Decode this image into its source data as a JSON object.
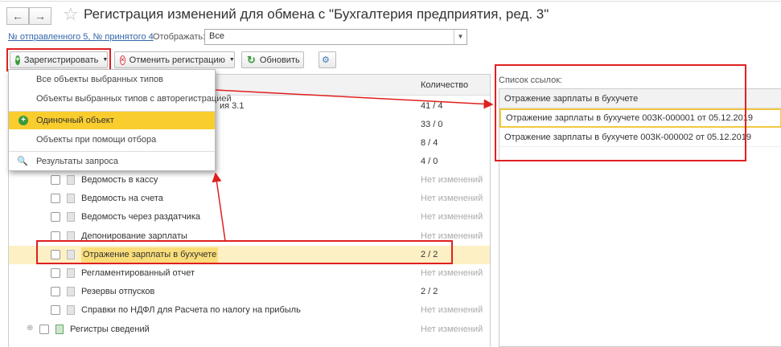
{
  "window": {
    "title": "Регистрация изменений для обмена с  \"Бухгалтерия предприятия, ред. 3\"",
    "back": "←",
    "forward": "→",
    "star": "☆"
  },
  "info": {
    "link": "№ отправленного 5, № принятого 4",
    "display_label": "Отображать:",
    "display_value": "Все"
  },
  "toolbar": {
    "register": "Зарегистрировать",
    "unregister": "Отменить регистрацию",
    "refresh": "Обновить"
  },
  "menu": {
    "items": [
      "Все объекты выбранных типов",
      "Объекты выбранных типов с авторегистрацией",
      "Одиночный объект",
      "Объекты при помощи отбора",
      "Результаты запроса"
    ]
  },
  "table": {
    "col_count": "Количество",
    "hidden_rows": [
      {
        "name": "ия 3.1",
        "count": "41 / 4"
      },
      {
        "count": "33 / 0"
      },
      {
        "count": "8 / 4"
      },
      {
        "count": "4 / 0"
      }
    ],
    "rows": [
      {
        "name": "Ведомость в кассу",
        "count": "Нет изменений"
      },
      {
        "name": "Ведомость на счета",
        "count": "Нет изменений"
      },
      {
        "name": "Ведомость через раздатчика",
        "count": "Нет изменений"
      },
      {
        "name": "Депонирование зарплаты",
        "count": "Нет изменений"
      },
      {
        "name": "Отражение зарплаты в бухучете",
        "count": "2 / 2"
      },
      {
        "name": "Регламентированный отчет",
        "count": "Нет изменений"
      },
      {
        "name": "Резервы отпусков",
        "count": "2 / 2"
      },
      {
        "name": "Справки по НДФЛ для Расчета по налогу на прибыль",
        "count": "Нет изменений"
      }
    ],
    "group": {
      "name": "Регистры сведений",
      "count": "Нет изменений"
    }
  },
  "refs": {
    "label": "Список ссылок:",
    "header": "Отражение зарплаты в бухучете",
    "rows": [
      "Отражение зарплаты в бухучете 00ЗК-000001 от 05.12.2019",
      "Отражение зарплаты в бухучете 00ЗК-000002 от 05.12.2019"
    ]
  },
  "colors": {
    "highlight": "#f9cd2e",
    "annotation": "#e02020",
    "selected_row": "#fdf0c4"
  }
}
